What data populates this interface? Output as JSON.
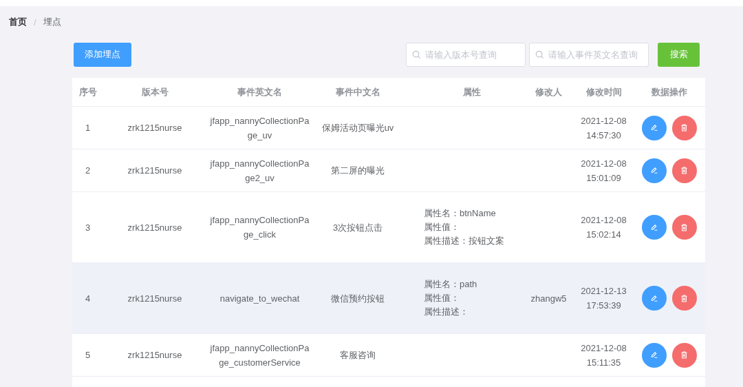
{
  "breadcrumb": {
    "separator": "/",
    "items": [
      {
        "label": "首页",
        "current": false
      },
      {
        "label": "埋点",
        "current": true
      }
    ]
  },
  "add_button": "添加埋点",
  "search_fields": [
    {
      "placeholder": "请输入版本号查询"
    },
    {
      "placeholder": "请输入事件英文名查询"
    }
  ],
  "search_button": "搜索",
  "table": {
    "columns": [
      "序号",
      "版本号",
      "事件英文名",
      "事件中文名",
      "属性",
      "修改人",
      "修改时间",
      "数据操作"
    ],
    "rows": [
      {
        "hovered": false,
        "seq": "1",
        "version": "zrk1215nurse",
        "event_en": "jfapp_nannyCollectionPage_uv",
        "event_cn": "保姆活动页曝光uv",
        "attributes": [],
        "modifier": "",
        "modified_time": "2021-12-08 14:57:30"
      },
      {
        "hovered": false,
        "seq": "2",
        "version": "zrk1215nurse",
        "event_en": "jfapp_nannyCollectionPage2_uv",
        "event_cn": "第二屏的曝光",
        "attributes": [],
        "modifier": "",
        "modified_time": "2021-12-08 15:01:09"
      },
      {
        "hovered": false,
        "seq": "3",
        "version": "zrk1215nurse",
        "event_en": "jfapp_nannyCollectionPage_click",
        "event_cn": "3次按钮点击",
        "attributes": [
          "属性名：btnName",
          "属性值：",
          "属性描述：按钮文案"
        ],
        "modifier": "",
        "modified_time": "2021-12-08 15:02:14"
      },
      {
        "hovered": true,
        "seq": "4",
        "version": "zrk1215nurse",
        "event_en": "navigate_to_wechat",
        "event_cn": "微信预约按钮",
        "attributes": [
          "属性名：path",
          "属性值：",
          "属性描述："
        ],
        "modifier": "zhangw5",
        "modified_time": "2021-12-13 17:53:39"
      },
      {
        "hovered": false,
        "seq": "5",
        "version": "zrk1215nurse",
        "event_en": "jfapp_nannyCollectionPage_customerService",
        "event_cn": "客服咨询",
        "attributes": [],
        "modifier": "",
        "modified_time": "2021-12-08 15:11:35"
      }
    ]
  }
}
